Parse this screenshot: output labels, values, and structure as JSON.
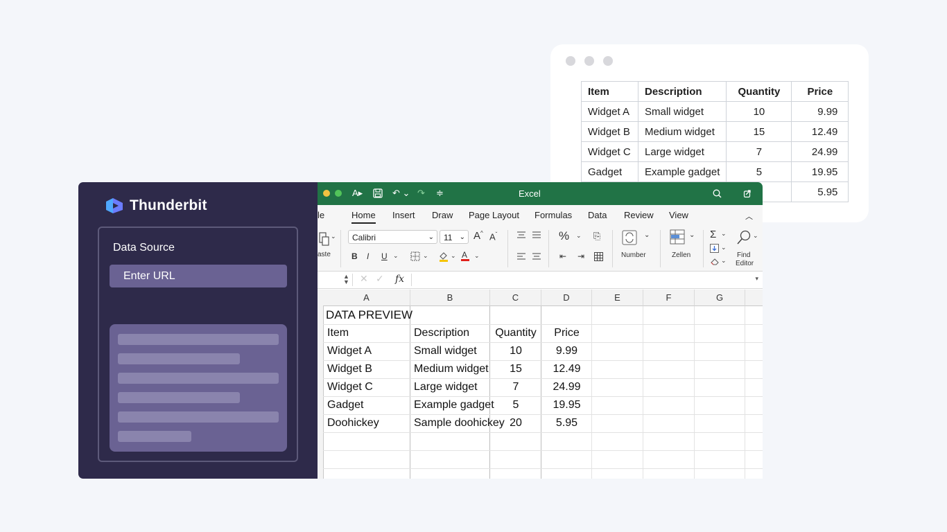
{
  "web_table": {
    "columns": [
      "Item",
      "Description",
      "Quantity",
      "Price"
    ],
    "rows": [
      [
        "Widget A",
        "Small widget",
        "10",
        "9.99"
      ],
      [
        "Widget B",
        "Medium widget",
        "15",
        "12.49"
      ],
      [
        "Widget C",
        "Large widget",
        "7",
        "24.99"
      ],
      [
        "Gadget",
        "Example gadget",
        "5",
        "19.95"
      ],
      [
        "",
        "",
        "",
        "5.95"
      ]
    ]
  },
  "thunderbit": {
    "brand": "Thunderbit",
    "data_source_label": "Data Source",
    "url_placeholder": "Enter URL"
  },
  "excel": {
    "window_title": "Excel",
    "tabs": [
      "le",
      "Home",
      "Insert",
      "Draw",
      "Page Layout",
      "Formulas",
      "Data",
      "Review",
      "View"
    ],
    "active_tab": "Home",
    "ribbon": {
      "paste_label": "aste",
      "font_name": "Calibri",
      "font_size": "11",
      "number_label": "Number",
      "cells_label": "Zellen",
      "find_label_1": "Find",
      "find_label_2": "Editor",
      "bold": "B",
      "italic": "I",
      "underline": "U",
      "percent": "%",
      "grow_font": "A",
      "shrink_font": "A"
    },
    "formula_bar": {
      "fx": "fx"
    },
    "column_headers": [
      "A",
      "B",
      "C",
      "D",
      "E",
      "F",
      "G"
    ],
    "sheet_title": "DATA PREVIEW",
    "sheet_columns": [
      "Item",
      "Description",
      "Quantity",
      "Price"
    ],
    "sheet_rows": [
      [
        "Widget A",
        "Small widget",
        "10",
        "9.99"
      ],
      [
        "Widget B",
        "Medium widget",
        "15",
        "12.49"
      ],
      [
        "Widget C",
        "Large widget",
        "7",
        "24.99"
      ],
      [
        "Gadget",
        "Example gadget",
        "5",
        "19.95"
      ],
      [
        "Doohickey",
        "Sample doohickey",
        "20",
        "5.95"
      ]
    ]
  },
  "colors": {
    "page_bg": "#f4f6fa",
    "thunderbit_bg": "#2e2a4a",
    "thunderbit_input": "#6a6293",
    "excel_green": "#217346"
  }
}
